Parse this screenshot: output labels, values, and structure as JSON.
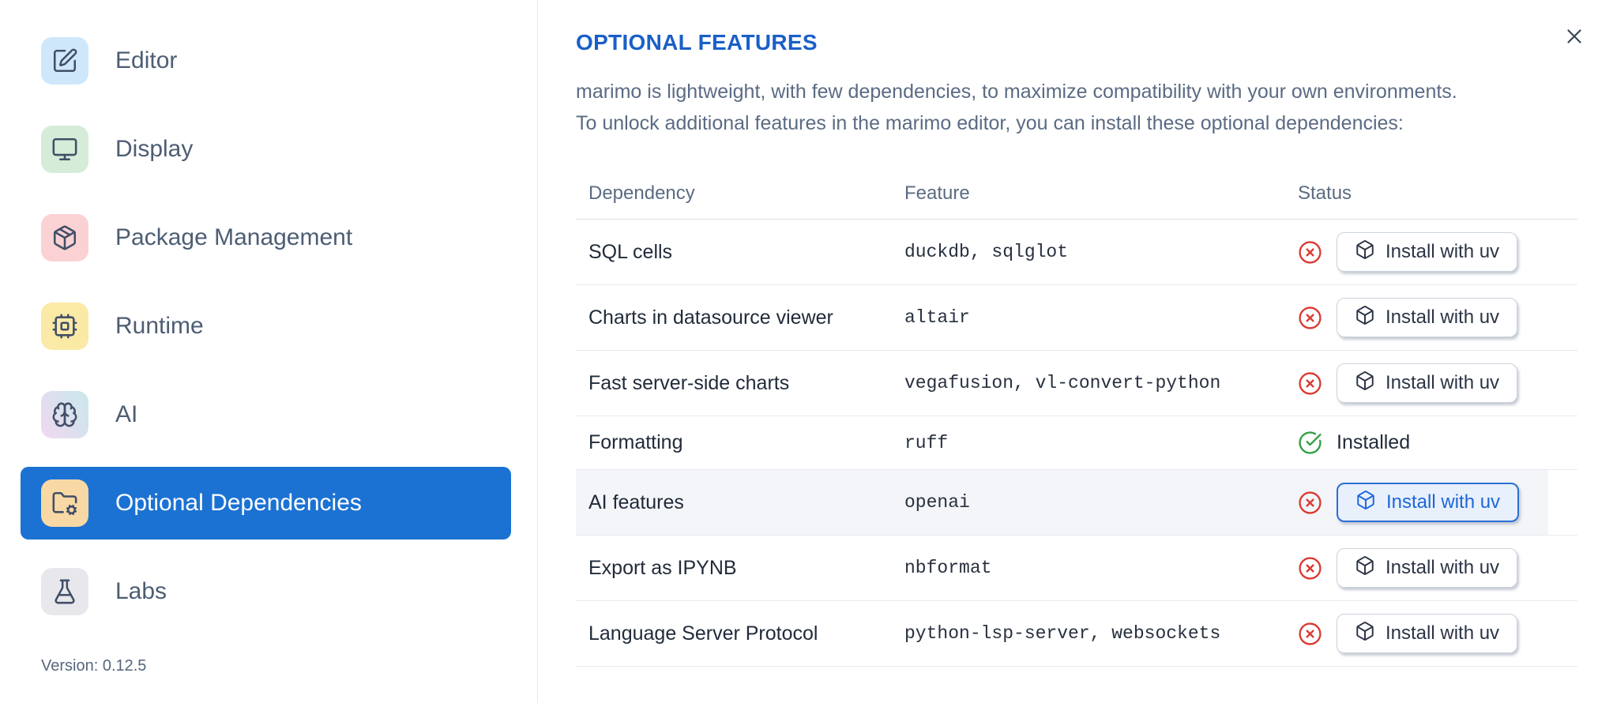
{
  "sidebar": {
    "items": [
      {
        "label": "Editor",
        "icon": "edit-icon"
      },
      {
        "label": "Display",
        "icon": "monitor-icon"
      },
      {
        "label": "Package Management",
        "icon": "package-icon"
      },
      {
        "label": "Runtime",
        "icon": "cpu-icon"
      },
      {
        "label": "AI",
        "icon": "brain-icon"
      },
      {
        "label": "Optional Dependencies",
        "icon": "folder-cog-icon",
        "selected": true
      },
      {
        "label": "Labs",
        "icon": "flask-icon"
      }
    ],
    "version": "Version: 0.12.5"
  },
  "dialog": {
    "close_icon": "x"
  },
  "main": {
    "title": "OPTIONAL FEATURES",
    "description_line1": "marimo is lightweight, with few dependencies, to maximize compatibility with your own environments.",
    "description_line2": "To unlock additional features in the marimo editor, you can install these optional dependencies:",
    "table": {
      "headers": [
        "Dependency",
        "Feature",
        "Status"
      ],
      "install_button_label": "Install with uv",
      "installed_label": "Installed",
      "rows": [
        {
          "dependency": "SQL cells",
          "feature": "duckdb, sqlglot",
          "installed": false
        },
        {
          "dependency": "Charts in datasource viewer",
          "feature": "altair",
          "installed": false
        },
        {
          "dependency": "Fast server-side charts",
          "feature": "vegafusion, vl-convert-python",
          "installed": false
        },
        {
          "dependency": "Formatting",
          "feature": "ruff",
          "installed": true
        },
        {
          "dependency": "AI features",
          "feature": "openai",
          "installed": false,
          "highlighted": true,
          "button_focused": true
        },
        {
          "dependency": "Export as IPYNB",
          "feature": "nbformat",
          "installed": false
        },
        {
          "dependency": "Language Server Protocol",
          "feature": "python-lsp-server, websockets",
          "installed": false
        }
      ]
    }
  },
  "icons": {
    "edit-icon": "pencil-in-square",
    "monitor-icon": "monitor",
    "package-icon": "package-cube",
    "cpu-icon": "cpu-chip",
    "brain-icon": "brain",
    "folder-cog-icon": "folder-with-gear",
    "flask-icon": "conical-flask",
    "box-icon": "cube",
    "not-installed-icon": "circle-x",
    "installed-icon": "circle-check",
    "close-icon": "x"
  },
  "colors": {
    "selected_item_blue": "#1b72d3",
    "title_blue": "#1a5fc8",
    "error_red": "#d93a32",
    "success_green": "#2f9e44",
    "focused_button_blue": "#2b6fd2",
    "row_highlight": "#f3f5f8"
  }
}
